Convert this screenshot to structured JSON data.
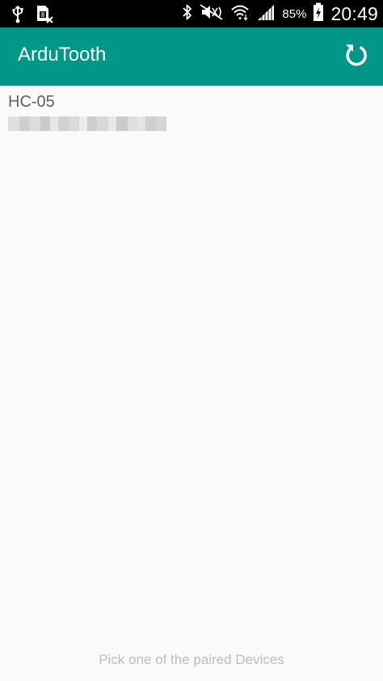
{
  "status_bar": {
    "battery_percent": "85%",
    "time": "20:49",
    "left_icons": [
      "usb-icon",
      "no-sim-icon"
    ],
    "right_icons": [
      "bluetooth-icon",
      "mute-icon",
      "wifi-icon",
      "signal-icon",
      "battery-charging-icon"
    ]
  },
  "app_bar": {
    "title": "ArduTooth",
    "action_icon": "refresh-icon",
    "color": "#009688"
  },
  "devices": [
    {
      "name": "HC-05",
      "address_visible": false
    }
  ],
  "hint": "Pick one of the paired Devices"
}
